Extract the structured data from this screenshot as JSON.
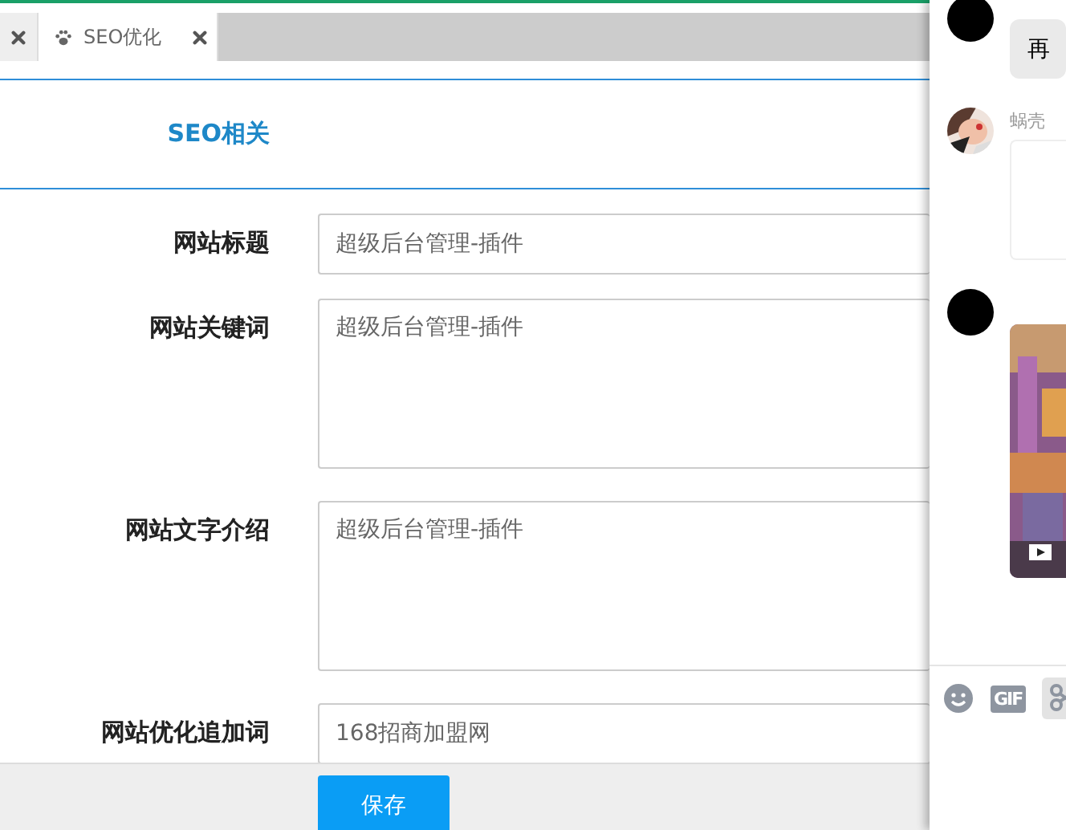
{
  "tabs": [
    {
      "selected": false
    },
    {
      "label": "SEO优化",
      "selected": true
    }
  ],
  "section_title": "SEO相关",
  "fields": [
    {
      "label": "网站标题",
      "kind": "input",
      "value": "超级后台管理-插件"
    },
    {
      "label": "网站关键词",
      "kind": "textarea",
      "value": "超级后台管理-插件"
    },
    {
      "label": "网站文字介绍",
      "kind": "textarea",
      "value": "超级后台管理-插件"
    },
    {
      "label": "网站优化追加词",
      "kind": "input",
      "value": "168招商加盟网"
    }
  ],
  "save_button": "保存",
  "chat": {
    "messages": [
      {
        "kind": "bubble",
        "photo_avatar": false,
        "text": "再"
      },
      {
        "kind": "card",
        "photo_avatar": true,
        "sender": "蜗壳"
      },
      {
        "kind": "video",
        "photo_avatar": false
      }
    ],
    "toolbar": [
      {
        "kind": "emoji",
        "selected": false
      },
      {
        "kind": "gif",
        "label": "GIF",
        "selected": false
      },
      {
        "kind": "scissors",
        "selected": true
      }
    ]
  }
}
